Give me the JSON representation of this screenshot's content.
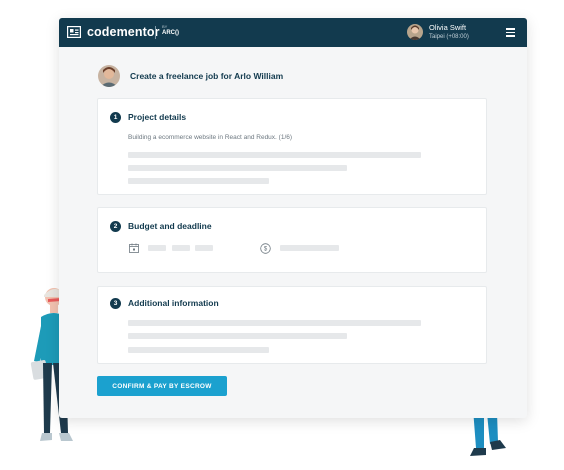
{
  "app": {
    "logo_text": "codementor",
    "logo_by": "BY",
    "logo_parent": "ARC()"
  },
  "user": {
    "name": "Olivia Swift",
    "timezone": "Taipei (+08:00)"
  },
  "icons": {
    "logo": "codementor-logo-icon",
    "menu": "hamburger-menu-icon",
    "calendar": "calendar-icon",
    "money": "dollar-icon"
  },
  "page": {
    "title": "Create a freelance job for Arlo William"
  },
  "sections": [
    {
      "number": "1",
      "title": "Project details",
      "description": "Building a ecommerce website in React and Redux. (1/6)"
    },
    {
      "number": "2",
      "title": "Budget and deadline"
    },
    {
      "number": "3",
      "title": "Additional information"
    }
  ],
  "actions": {
    "confirm_label": "CONFIRM & PAY BY ESCROW"
  },
  "colors": {
    "topbar": "#123a4e",
    "accent": "#1ba1cf",
    "placeholder": "#e6e8ea"
  }
}
